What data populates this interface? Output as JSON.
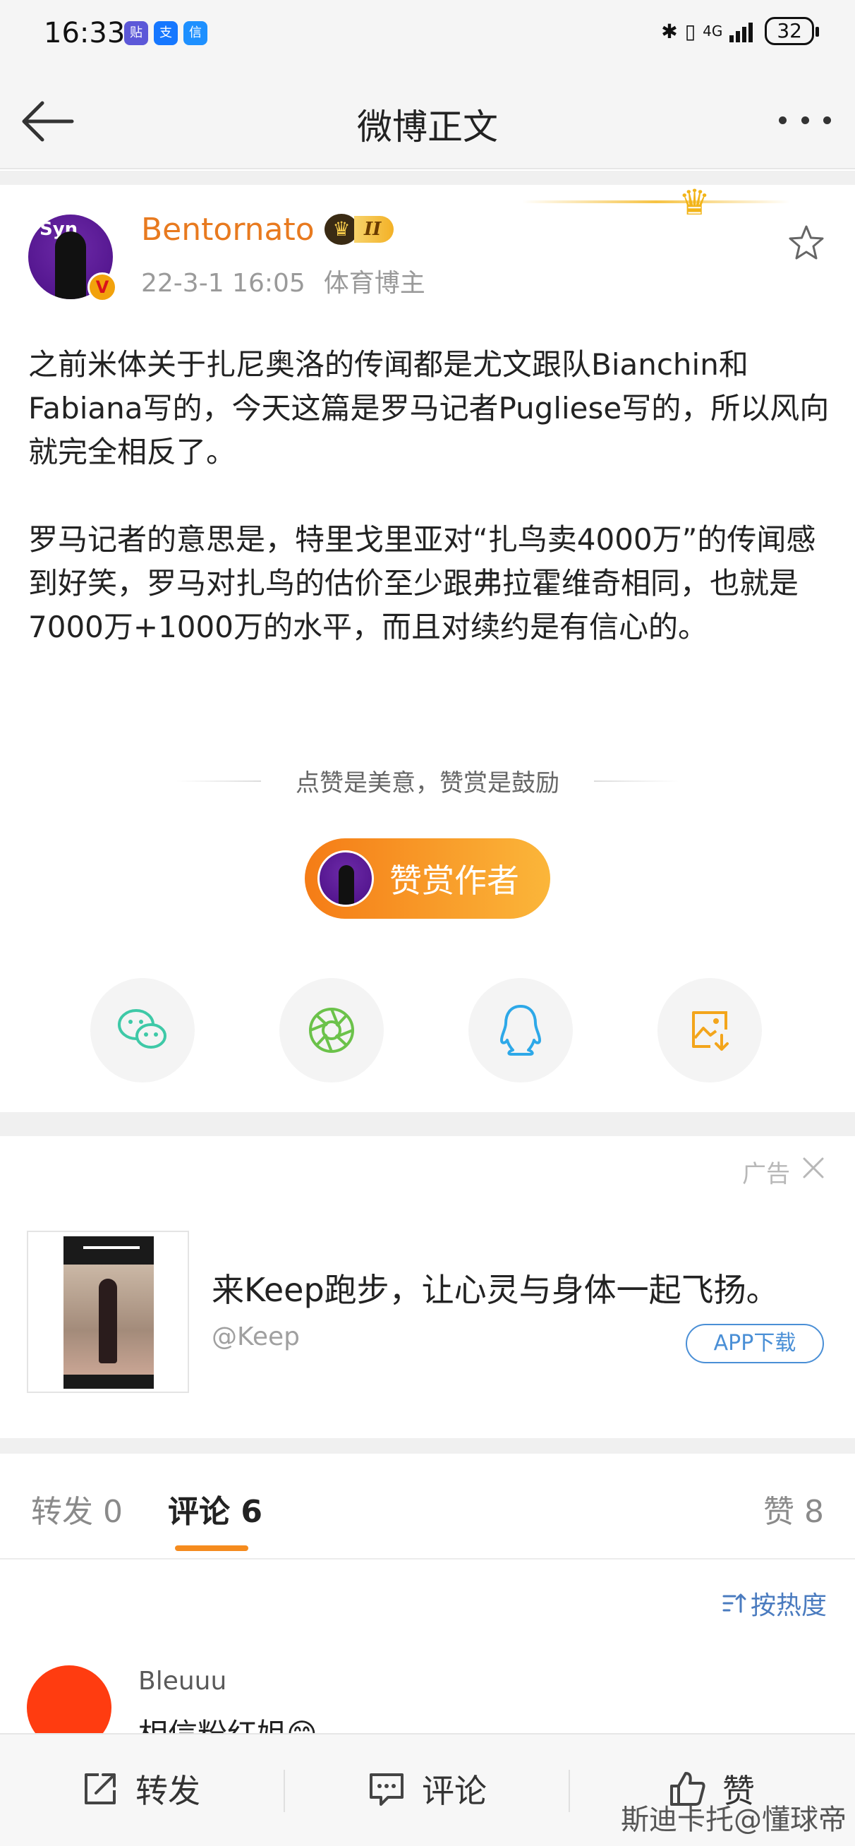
{
  "status_bar": {
    "time": "16:33",
    "network": "4G",
    "battery": "32",
    "apps": [
      "贴",
      "支",
      "信"
    ]
  },
  "nav": {
    "title": "微博正文",
    "back_icon": "arrow-left-icon",
    "more_icon": "more-dots-icon"
  },
  "post": {
    "author": "Bentornato",
    "vip_level": "II",
    "verified_badge": "V",
    "date": "22-3-1 16:05",
    "author_tag": "体育博主",
    "avatar_text": "Syn",
    "paragraphs": [
      "之前米体关于扎尼奥洛的传闻都是尤文跟队Bianchin和Fabiana写的，今天这篇是罗马记者Pugliese写的，所以风向就完全相反了。",
      "罗马记者的意思是，特里戈里亚对“扎鸟卖4000万”的传闻感到好笑，罗马对扎鸟的估价至少跟弗拉霍维奇相同，也就是7000万+1000万的水平，而且对续约是有信心的。"
    ]
  },
  "reward": {
    "hint": "点赞是美意，赞赏是鼓励",
    "button_label": "赞赏作者"
  },
  "share": {
    "items": [
      "wechat-icon",
      "moments-icon",
      "qq-icon",
      "save-image-icon"
    ]
  },
  "ad": {
    "tag": "广告",
    "text": "来Keep跑步，让心灵与身体一起飞扬。",
    "handle": "@Keep",
    "download_label": "APP下载"
  },
  "tabs": {
    "repost": "转发 0",
    "comments": "评论 6",
    "likes": "赞 8"
  },
  "sort_label": "按热度",
  "comments": [
    {
      "user": "Bleuuu",
      "text": "相信粉红姐😊"
    }
  ],
  "bottom_bar": {
    "repost": "转发",
    "comment": "评论",
    "like": "赞"
  },
  "watermark": "斯迪卡托@懂球帝",
  "colors": {
    "accent_orange": "#f58b1e",
    "username_orange": "#e87a1f",
    "link_blue": "#4a7bbf"
  }
}
